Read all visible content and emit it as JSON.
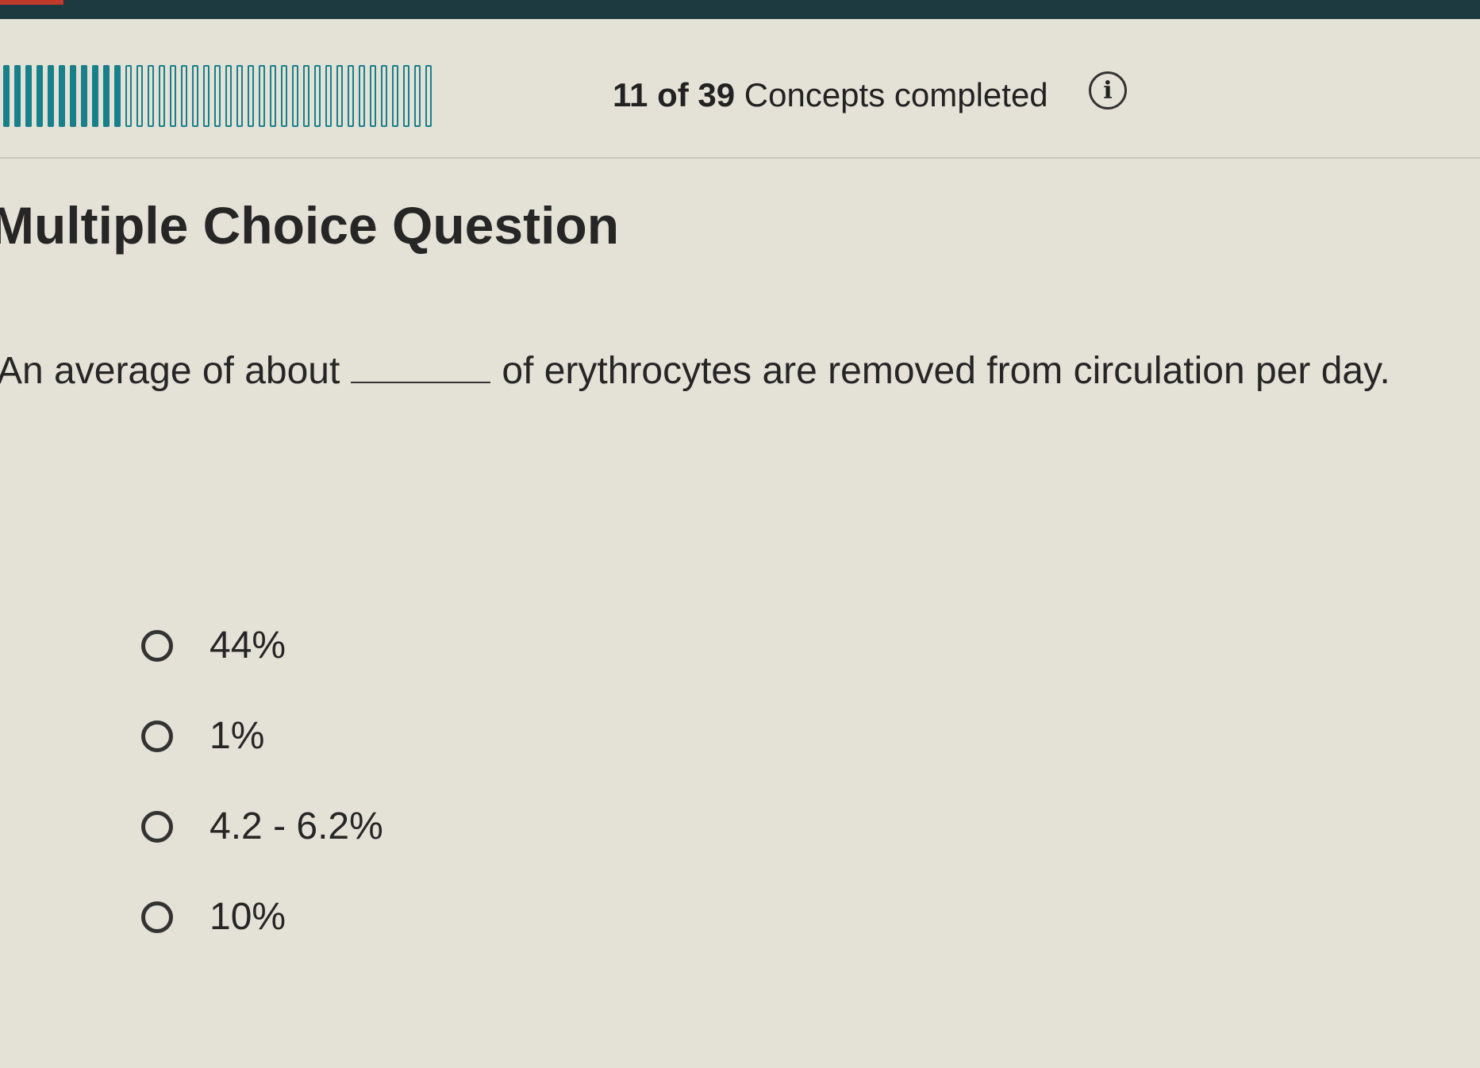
{
  "progress": {
    "completed": 11,
    "total": 39,
    "count_text": "11 of 39",
    "label_text": " Concepts completed"
  },
  "icons": {
    "info": "info-icon",
    "radio": "radio-icon"
  },
  "info_glyph": "i",
  "question": {
    "type_title": "Multiple Choice Question",
    "prompt_before": "An average of about",
    "prompt_after": "of erythrocytes are removed from circulation per day."
  },
  "options": [
    {
      "label": "44%"
    },
    {
      "label": "1%"
    },
    {
      "label": "4.2 - 6.2%"
    },
    {
      "label": "10%"
    }
  ],
  "colors": {
    "accent": "#17808a",
    "background": "#e4e1d7"
  }
}
